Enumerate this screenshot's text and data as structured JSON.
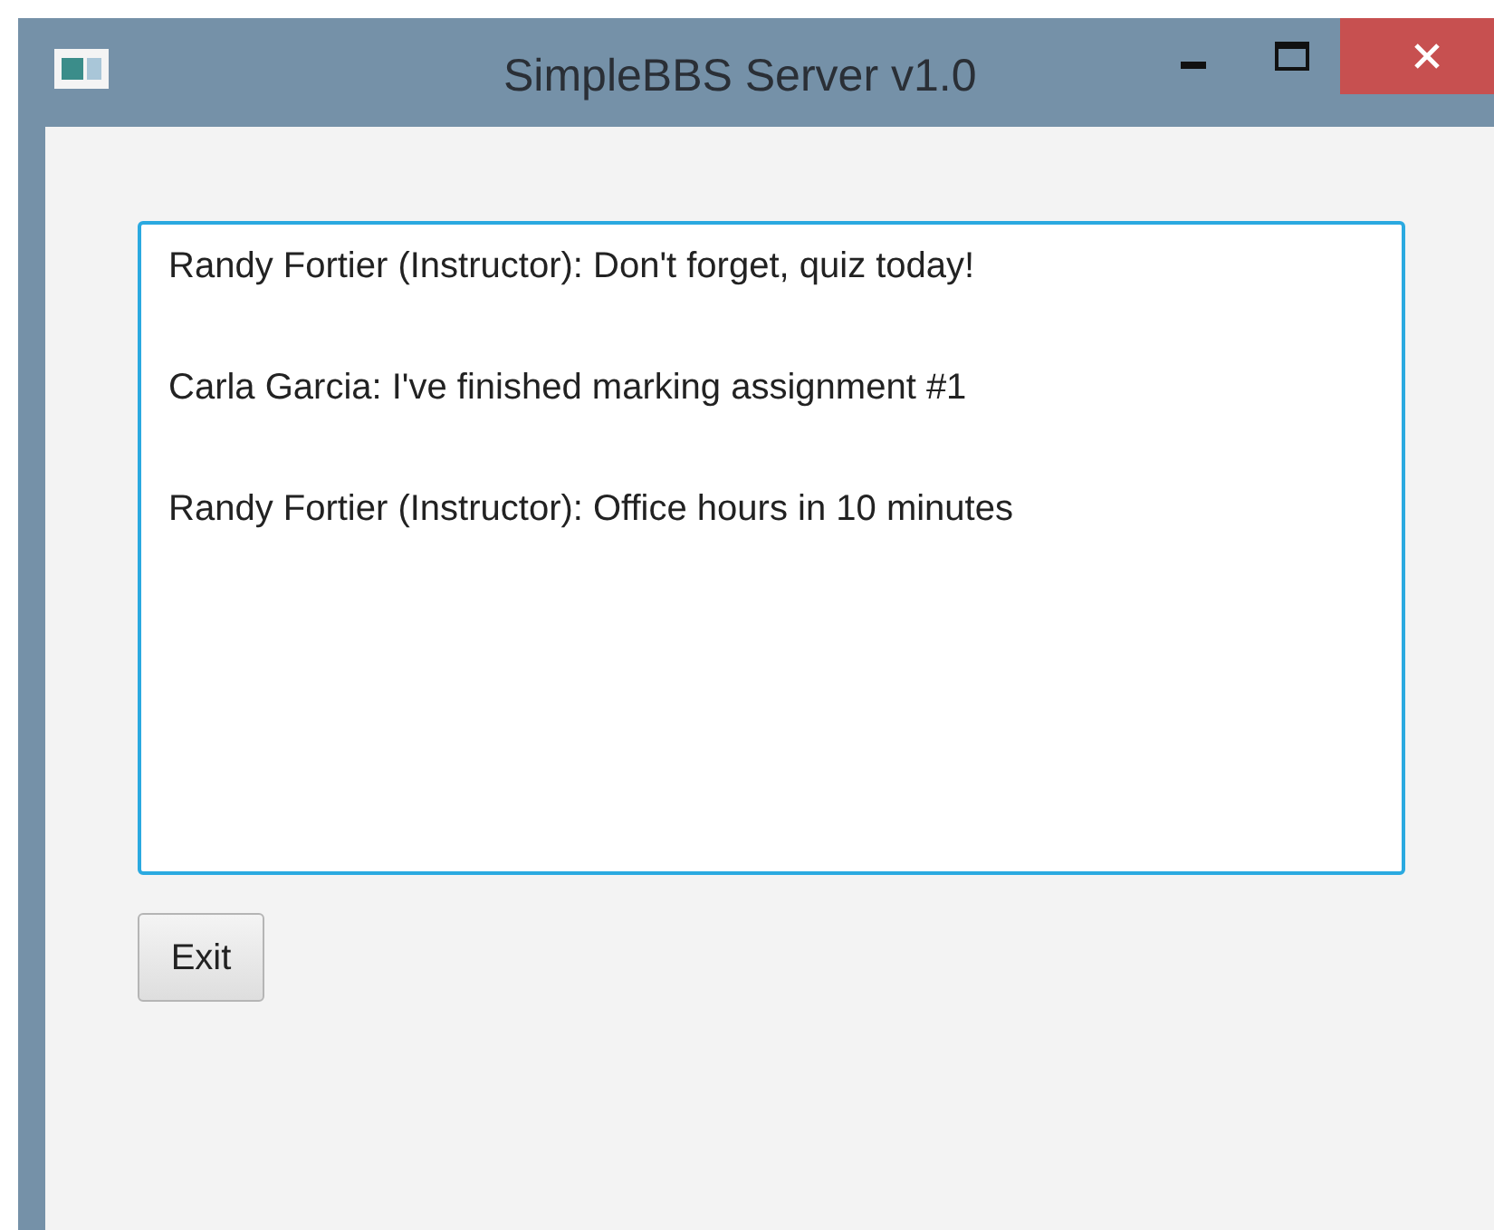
{
  "window": {
    "title": "SimpleBBS Server v1.0",
    "focused": true
  },
  "messages": [
    "Randy Fortier (Instructor): Don't forget, quiz today!",
    "Carla Garcia: I've finished marking assignment #1",
    "Randy Fortier (Instructor): Office hours in 10 minutes"
  ],
  "buttons": [
    "Exit"
  ]
}
